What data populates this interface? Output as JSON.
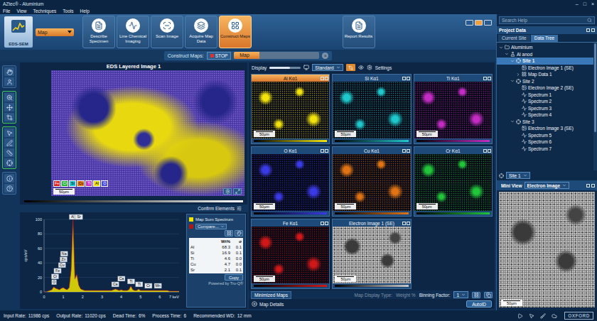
{
  "window": {
    "title": "AZtec® - Aluminium",
    "controls": [
      "–",
      "□",
      "×"
    ]
  },
  "menu": [
    "File",
    "View",
    "Techniques",
    "Tools",
    "Help"
  ],
  "ribbon": {
    "mode": "EDS-SEM",
    "dropdown": "Map",
    "steps": [
      {
        "label": "Describe Specimen",
        "selected": false
      },
      {
        "label": "Line Chemical Imaging",
        "selected": false
      },
      {
        "label": "Scan Image",
        "selected": false
      },
      {
        "label": "Acquire Map Data",
        "selected": false
      },
      {
        "label": "Construct Maps",
        "selected": true
      }
    ],
    "report": "Report Results",
    "views": [
      {
        "selected": false
      },
      {
        "selected": true
      },
      {
        "selected": false
      }
    ]
  },
  "construct_bar": {
    "label": "Construct Maps:",
    "stop": "STOP",
    "run": "Map",
    "level": 0.3,
    "close": "×"
  },
  "layered_image": {
    "title": "EDS Layered Image 1",
    "scale": "50µm",
    "layers": [
      {
        "label": "Fe",
        "color": "#d42020"
      },
      {
        "label": "Cr",
        "color": "#22b83a"
      },
      {
        "label": "Si",
        "color": "#20c8d0"
      },
      {
        "label": "Cu",
        "color": "#e07818"
      },
      {
        "label": "Ti",
        "color": "#c830c8"
      },
      {
        "label": "Al",
        "color": "#f0e010"
      },
      {
        "label": "O",
        "color": "#4a4ae8"
      }
    ]
  },
  "confirm_elements": "Confirm Elements",
  "spectrum": {
    "y_label": "cps/eV",
    "y_ticks": [
      "0",
      "20",
      "40",
      "60",
      "80",
      "100"
    ],
    "x_ticks": [
      "0",
      "1",
      "2",
      "3",
      "4",
      "5",
      "6",
      "7 keV"
    ],
    "values": [
      0,
      0,
      1,
      2,
      3,
      7,
      5,
      4,
      3,
      5,
      6,
      4,
      3,
      6,
      30,
      100,
      18,
      24,
      9,
      4,
      3,
      2,
      2,
      2,
      2,
      2,
      2,
      2,
      2,
      2,
      2,
      2,
      2,
      2,
      2,
      2,
      3,
      4,
      3,
      2,
      3,
      2,
      2,
      2,
      3,
      8,
      3,
      2,
      2,
      4,
      2,
      2,
      2,
      2,
      2,
      2,
      2,
      2,
      2,
      2,
      2,
      2,
      2,
      2,
      2,
      1,
      1,
      1,
      1,
      1,
      1
    ],
    "peaks": [
      {
        "label": "O",
        "kev": 0.52
      },
      {
        "label": "Cr",
        "kev": 0.57
      },
      {
        "label": "Fe",
        "kev": 0.7
      },
      {
        "label": "Cu",
        "kev": 0.93
      },
      {
        "label": "Zn",
        "kev": 1.01
      },
      {
        "label": "Na",
        "kev": 1.04
      },
      {
        "label": "Al",
        "kev": 1.49
      },
      {
        "label": "Si",
        "kev": 1.74
      },
      {
        "label": "Sr",
        "kev": 1.81
      },
      {
        "label": "Ca",
        "kev": 3.69
      },
      {
        "label": "Ca",
        "kev": 4.01
      },
      {
        "label": "Ti",
        "kev": 4.51
      },
      {
        "label": "Ti",
        "kev": 4.93
      },
      {
        "label": "Cr",
        "kev": 5.41
      },
      {
        "label": "Mn",
        "kev": 5.9
      }
    ]
  },
  "results": {
    "legend": [
      {
        "label": "Map Sum Spectrum",
        "color": "#f2e600",
        "kind": "plain"
      },
      {
        "label": "Compare...",
        "color": "#b01818",
        "kind": "dropdown"
      }
    ],
    "headers": [
      "",
      "Wt%",
      "σ"
    ],
    "rows": [
      [
        "Al",
        "68.3",
        "0.1"
      ],
      [
        "Si",
        "16.9",
        "0.1"
      ],
      [
        "Ti",
        "4.6",
        "0.0"
      ],
      [
        "Cu",
        "4.7",
        "0.0"
      ],
      [
        "Sr",
        "2.1",
        "0.1"
      ]
    ],
    "copy": "Copy",
    "powered": "Powered by Tru-Q®"
  },
  "maps_toolbar": {
    "label": "Display",
    "level": 0.65,
    "mode": "Standard",
    "settings": "Settings"
  },
  "maps": [
    {
      "label": "Al Kα1",
      "scale": "50µm",
      "color": "#f2e20e",
      "kind": "element",
      "selected": true
    },
    {
      "label": "Si Kα1",
      "scale": "50µm",
      "color": "#1fc8cc",
      "kind": "element",
      "selected": false
    },
    {
      "label": "Ti Kα1",
      "scale": "50µm",
      "color": "#c42cc4",
      "kind": "element",
      "selected": false
    },
    {
      "label": "O Kα1",
      "scale": "50µm",
      "color": "#3a3ae6",
      "kind": "element",
      "selected": false
    },
    {
      "label": "Cu Kα1",
      "scale": "50µm",
      "color": "#e07414",
      "kind": "element",
      "selected": false
    },
    {
      "label": "Cr Kα1",
      "scale": "50µm",
      "color": "#22c43a",
      "kind": "element",
      "selected": false
    },
    {
      "label": "Fe Kα1",
      "scale": "50µm",
      "color": "#d01818",
      "kind": "element",
      "selected": false
    },
    {
      "label": "Electron Image 1 (SE)",
      "scale": "50µm",
      "color": "#c8c8c8",
      "kind": "electron",
      "selected": false
    }
  ],
  "minimized": "Minimized Maps",
  "display_type": {
    "label": "Map Display Type:",
    "value": "Weight %",
    "disabled": true
  },
  "binning": {
    "label": "Binning Factor:",
    "value": "1"
  },
  "details": "Map Details",
  "autoid": "AutoID",
  "search": {
    "placeholder": "Search Help"
  },
  "project": {
    "title": "Project Data",
    "tabs": [
      {
        "label": "Current Site",
        "selected": false
      },
      {
        "label": "Data Tree",
        "selected": true
      }
    ],
    "tree": [
      {
        "label": "Aluminium",
        "depth": 0,
        "kind": "project",
        "expanded": true,
        "selected": false
      },
      {
        "label": "Al anod",
        "depth": 1,
        "kind": "specimen",
        "expanded": true,
        "selected": false
      },
      {
        "label": "Site 1",
        "depth": 2,
        "kind": "site",
        "expanded": true,
        "selected": true
      },
      {
        "label": "Electron Image 1 (SE)",
        "depth": 3,
        "kind": "image",
        "expanded": false,
        "selected": false
      },
      {
        "label": "Map Data 1",
        "depth": 3,
        "kind": "mapdata",
        "expanded": false,
        "selected": false
      },
      {
        "label": "Site 2",
        "depth": 2,
        "kind": "site",
        "expanded": true,
        "selected": false
      },
      {
        "label": "Electron Image 2 (SE)",
        "depth": 3,
        "kind": "image",
        "expanded": false,
        "selected": false
      },
      {
        "label": "Spectrum 1",
        "depth": 3,
        "kind": "spectrum",
        "expanded": false,
        "selected": false
      },
      {
        "label": "Spectrum 2",
        "depth": 3,
        "kind": "spectrum",
        "expanded": false,
        "selected": false
      },
      {
        "label": "Spectrum 3",
        "depth": 3,
        "kind": "spectrum",
        "expanded": false,
        "selected": false
      },
      {
        "label": "Spectrum 4",
        "depth": 3,
        "kind": "spectrum",
        "expanded": false,
        "selected": false
      },
      {
        "label": "Site 3",
        "depth": 2,
        "kind": "site",
        "expanded": true,
        "selected": false
      },
      {
        "label": "Electron Image 3 (SE)",
        "depth": 3,
        "kind": "image",
        "expanded": false,
        "selected": false
      },
      {
        "label": "Spectrum 5",
        "depth": 3,
        "kind": "spectrum",
        "expanded": false,
        "selected": false
      },
      {
        "label": "Spectrum 6",
        "depth": 3,
        "kind": "spectrum",
        "expanded": false,
        "selected": false
      },
      {
        "label": "Spectrum 7",
        "depth": 3,
        "kind": "spectrum",
        "expanded": false,
        "selected": false
      }
    ]
  },
  "site_select": "Site 1",
  "mini_view": {
    "title": "Mini View",
    "mode": "Electron Image",
    "scale": "50µm"
  },
  "status": [
    {
      "label": "Input Rate:",
      "value": "11986 cps"
    },
    {
      "label": "Output Rate:",
      "value": "11020 cps"
    },
    {
      "label": "Dead Time:",
      "value": "6%"
    },
    {
      "label": "Process Time:",
      "value": "6"
    },
    {
      "label": "Recommended WD:",
      "value": "12 mm"
    }
  ],
  "logo": "OXFORD"
}
